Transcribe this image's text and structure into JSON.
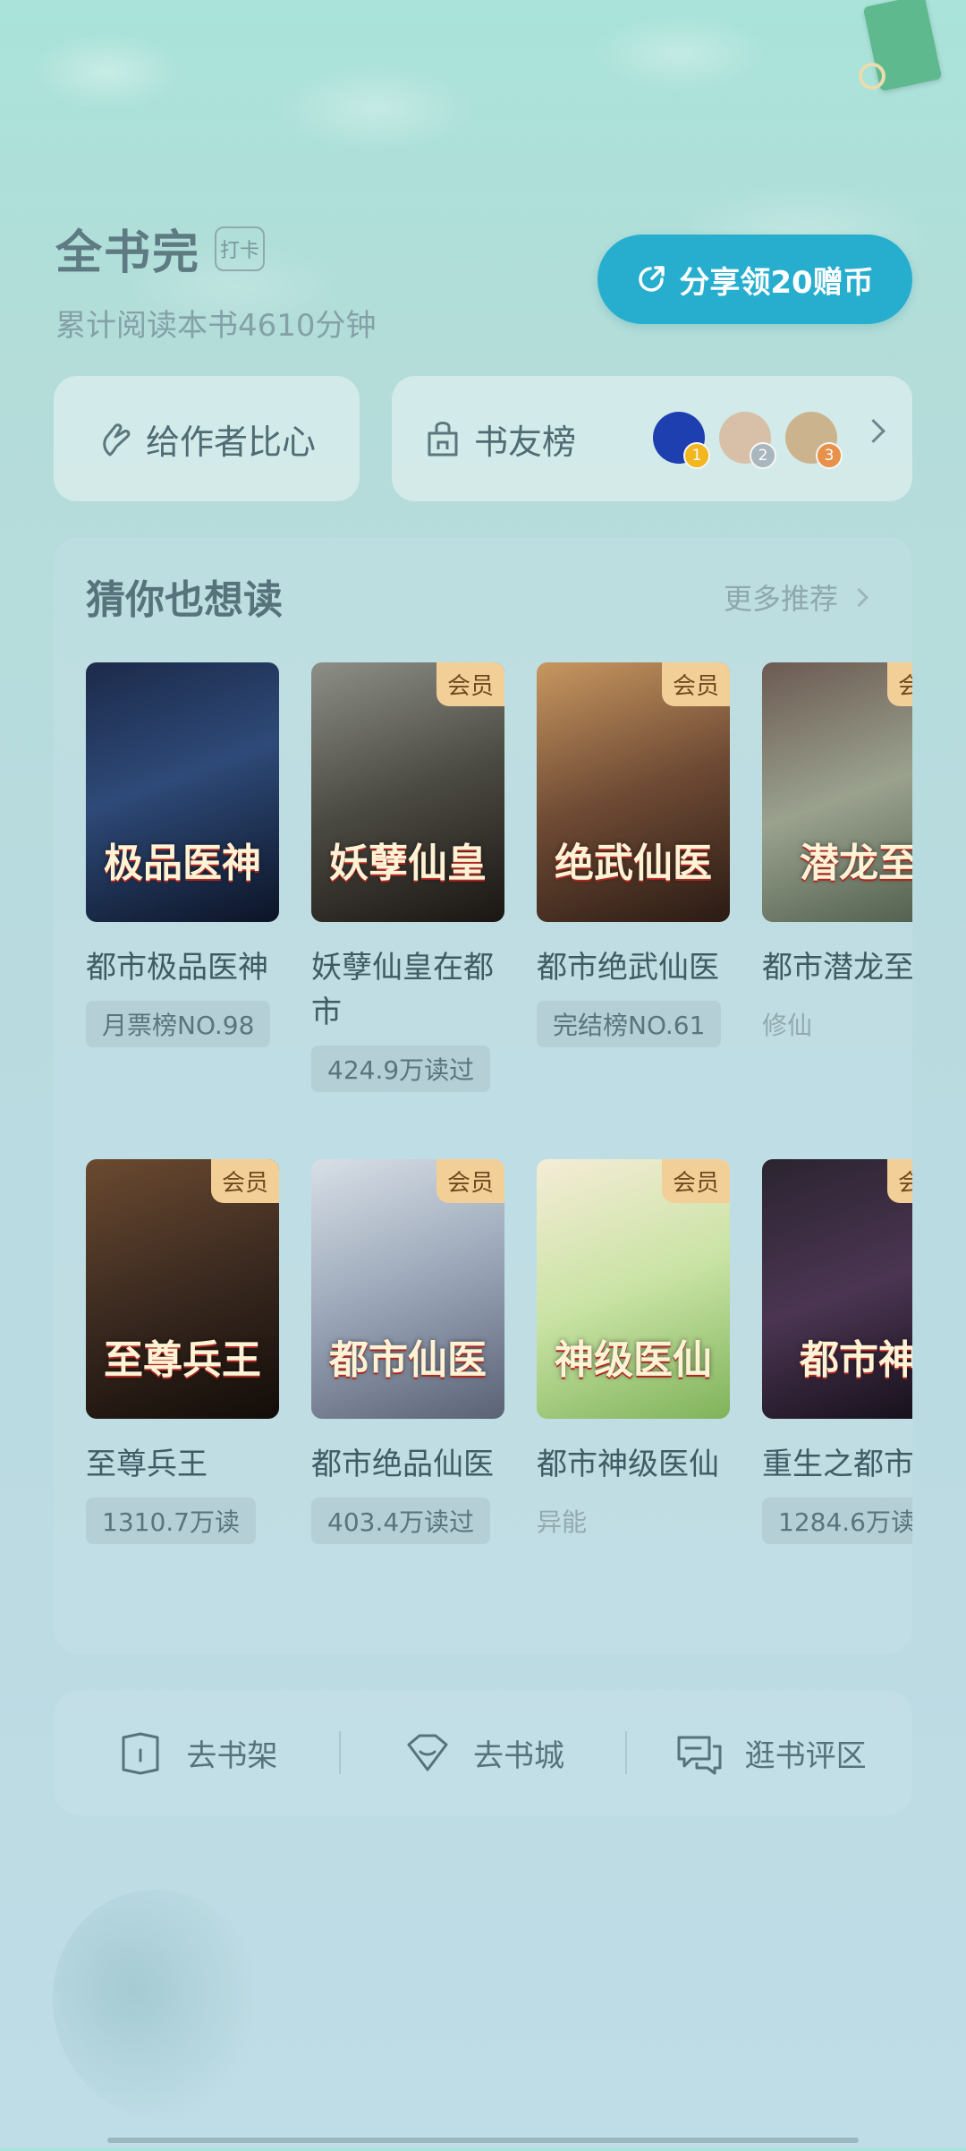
{
  "header": {
    "title": "全书完",
    "checkin_label": "打卡",
    "subtitle": "累计阅读本书4610分钟",
    "share_label": "分享领20赠币"
  },
  "actions": {
    "heart_label": "给作者比心",
    "rank_label": "书友榜",
    "avatars": [
      {
        "rank": "1",
        "color": "#1d3fb0",
        "badge": "#f2b720"
      },
      {
        "rank": "2",
        "color": "#d8c0a8",
        "badge": "#a9b6bd"
      },
      {
        "rank": "3",
        "color": "#cbb48d",
        "badge": "#e8914a"
      }
    ]
  },
  "recommend": {
    "title": "猜你也想读",
    "more_label": "更多推荐",
    "vip_label": "会员",
    "books": [
      {
        "name": "都市极品医神",
        "tag": "月票榜NO.98",
        "tag_style": "pill",
        "vip": false,
        "cover_text": "极品医神",
        "cover_bg": "linear-gradient(160deg,#1c2a4a 0%,#2e4a78 45%,#0c1426 100%)"
      },
      {
        "name": "妖孽仙皇在都市",
        "tag": "424.9万读过",
        "tag_style": "pill",
        "vip": true,
        "cover_text": "妖孽仙皇",
        "cover_bg": "linear-gradient(160deg,#8d8f86 0%,#4b4a42 50%,#1a1512 100%)"
      },
      {
        "name": "都市绝武仙医",
        "tag": "完结榜NO.61",
        "tag_style": "pill",
        "vip": true,
        "cover_text": "绝武仙医",
        "cover_bg": "linear-gradient(160deg,#c89760 0%,#6e4a34 50%,#2a1b14 100%)"
      },
      {
        "name": "都市潜龙至",
        "tag": "修仙",
        "tag_style": "plain",
        "vip": true,
        "cover_text": "潜龙至",
        "cover_bg": "linear-gradient(160deg,#6c5a52 0%,#9aa28e 50%,#4d5b4a 100%)"
      },
      {
        "name": "至尊兵王",
        "tag": "1310.7万读",
        "tag_style": "pill",
        "vip": true,
        "cover_text": "至尊兵王",
        "cover_bg": "linear-gradient(160deg,#6b4a30 0%,#3b2a20 50%,#120c08 100%)"
      },
      {
        "name": "都市绝品仙医",
        "tag": "403.4万读过",
        "tag_style": "pill",
        "vip": true,
        "cover_text": "都市仙医",
        "cover_bg": "linear-gradient(160deg,#d7dfe6 0%,#9aa6b8 50%,#5a6274 100%)"
      },
      {
        "name": "都市神级医仙",
        "tag": "异能",
        "tag_style": "plain",
        "vip": true,
        "cover_text": "神级医仙",
        "cover_bg": "linear-gradient(160deg,#f5ecd6 0%,#c9e3a4 50%,#7fb35a 100%)"
      },
      {
        "name": "重生之都市帝",
        "tag": "1284.6万读",
        "tag_style": "pill",
        "vip": true,
        "cover_text": "都市神",
        "cover_bg": "linear-gradient(160deg,#2b2430 0%,#4b3552 50%,#120d16 100%)"
      }
    ]
  },
  "bottom": {
    "shelf_label": "去书架",
    "store_label": "去书城",
    "comment_label": "逛书评区"
  }
}
